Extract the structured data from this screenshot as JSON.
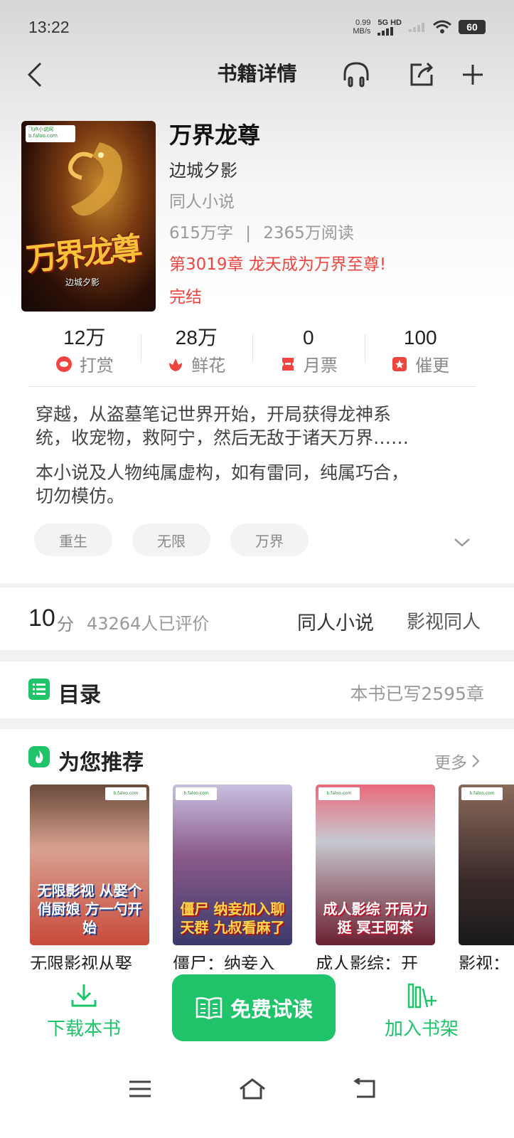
{
  "status_bar": {
    "time": "13:22",
    "net_speed_value": "0.99",
    "net_speed_unit": "MB/s",
    "network": "5G HD",
    "battery": "60"
  },
  "nav": {
    "title": "书籍详情",
    "icons": [
      "back-icon",
      "headphones-icon",
      "share-icon",
      "add-icon"
    ]
  },
  "book": {
    "title": "万界龙尊",
    "author": "边城夕影",
    "genre": "同人小说",
    "word_count": "615万字",
    "separator": "|",
    "reads": "2365万阅读",
    "latest_chapter": "第3019章 龙天成为万界至尊!",
    "status": "完结",
    "cover_title": "万界龙尊",
    "cover_author": "边城夕影",
    "cover_site": "飞卢小说网 b.faloo.com"
  },
  "counters": [
    {
      "value": "12万",
      "label": "打赏",
      "icon": "reward-icon"
    },
    {
      "value": "28万",
      "label": "鲜花",
      "icon": "flower-icon"
    },
    {
      "value": "0",
      "label": "月票",
      "icon": "monthly-ticket-icon"
    },
    {
      "value": "100",
      "label": "催更",
      "icon": "urge-update-icon"
    }
  ],
  "synopsis": {
    "line1": "穿越，从盗墓笔记世界开始，开局获得龙神系",
    "line2": "统，收宠物，救阿宁，然后无敌于诸天万界……",
    "disclaimer1": "本小说及人物纯属虚构，如有雷同，纯属巧合，",
    "disclaimer2": "切勿模仿。"
  },
  "tags": [
    "重生",
    "无限",
    "万界"
  ],
  "rating": {
    "score": "10",
    "unit": "分",
    "count": "43264人已评价",
    "category1": "同人小说",
    "category2": "影视同人"
  },
  "toc": {
    "title": "目录",
    "count": "本书已写2595章"
  },
  "recommend": {
    "title": "为您推荐",
    "more": "更多",
    "items": [
      {
        "name": "无限影视从娶",
        "cover_text": "无限影视 从娶个俏厨娘 方一勺开始",
        "color": "#c94a3a"
      },
      {
        "name": "僵尸：纳妾入",
        "cover_text": "僵尸 纳妾加入聊天群 九叔看麻了",
        "color": "#7a3a7a"
      },
      {
        "name": "成人影综：开",
        "cover_text": "成人影综 开局力挺 冥王阿茶",
        "color": "#b02a3a"
      },
      {
        "name": "影视：",
        "cover_text": "",
        "color": "#4a3a3a"
      }
    ]
  },
  "bottom": {
    "download": "下载本书",
    "read": "免费试读",
    "shelf": "加入书架"
  },
  "colors": {
    "accent": "#1fc46a",
    "highlight": "#f0453f"
  }
}
